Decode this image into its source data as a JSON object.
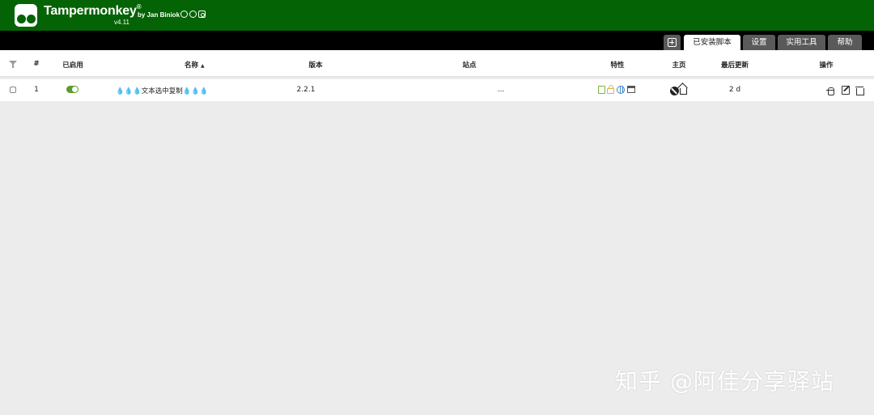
{
  "header": {
    "brand": "Tampermonkey",
    "registered": "®",
    "byline": "by Jan Biniok",
    "version": "v4.11",
    "social_icons": [
      "github-icon",
      "facebook-icon",
      "instagram-icon"
    ]
  },
  "tabs": [
    {
      "icon": "new-script-icon",
      "label": ""
    },
    {
      "label": "已安装脚本",
      "active": true
    },
    {
      "label": "设置",
      "active": false
    },
    {
      "label": "实用工具",
      "active": false
    },
    {
      "label": "帮助",
      "active": false
    }
  ],
  "table": {
    "columns": {
      "filter": "filter-icon",
      "index": "#",
      "enabled": "已启用",
      "name": "名称",
      "name_sort": "▲",
      "version": "版本",
      "sites": "站点",
      "features": "特性",
      "homepage": "主页",
      "updated": "最后更新",
      "actions": "操作"
    },
    "rows": [
      {
        "index": "1",
        "enabled": true,
        "name": "💧💧💧文本选中复制💧💧💧",
        "version": "2.2.1",
        "sites": "...",
        "features": [
          "page-icon",
          "lock-icon",
          "globe-icon",
          "window-icon"
        ],
        "homepage": [
          "author-icon",
          "home-icon"
        ],
        "updated": "2 d",
        "actions": [
          "bug-report-icon",
          "edit-icon",
          "trash-icon"
        ]
      }
    ]
  },
  "watermark": "知乎 @阿佳分享驿站",
  "colors": {
    "header_bg": "#046304",
    "tabbar_bg": "#000000",
    "toggle_on": "#5b9b2a",
    "page_bg": "#ececec"
  }
}
